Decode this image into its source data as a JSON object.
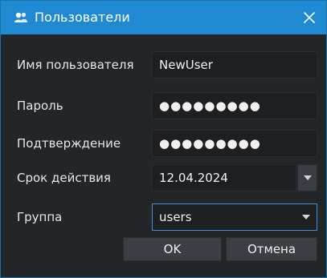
{
  "window": {
    "title": "Пользователи",
    "title_icon": "users-icon",
    "close_icon": "close-icon"
  },
  "form": {
    "username": {
      "label": "Имя пользователя",
      "value": "NewUser"
    },
    "password": {
      "label": "Пароль",
      "value": "●●●●●●●●●"
    },
    "confirm": {
      "label": "Подтверждение",
      "value": "●●●●●●●●●"
    },
    "expiry": {
      "label": "Срок действия",
      "value": "12.04.2024",
      "dropdown_icon": "chevron-down-icon"
    },
    "group": {
      "label": "Группа",
      "value": "users",
      "dropdown_icon": "chevron-down-icon"
    }
  },
  "buttons": {
    "ok": "OK",
    "cancel": "Отмена"
  },
  "colors": {
    "titlebar": "#1f8ad1",
    "background": "#232629",
    "field": "#1d1f21",
    "accent_border": "#3d8fd6"
  }
}
